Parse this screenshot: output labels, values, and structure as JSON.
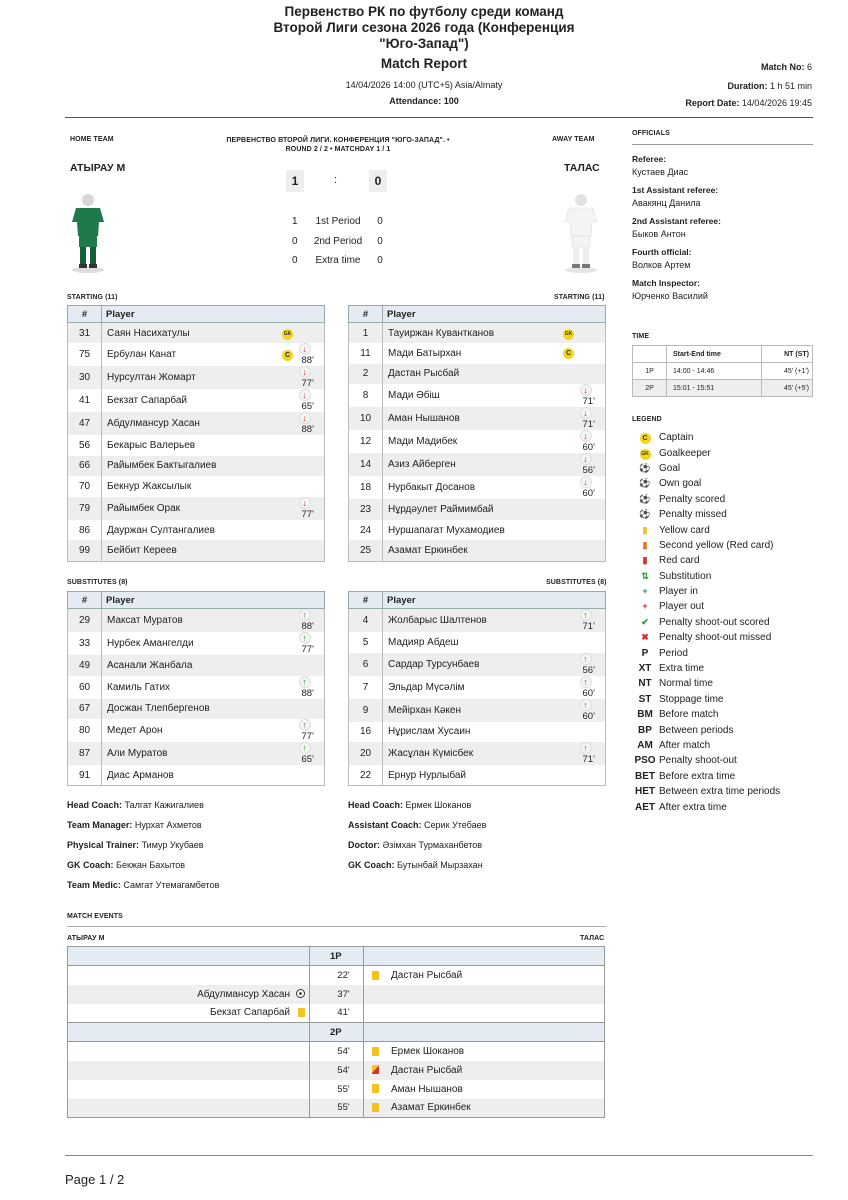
{
  "header": {
    "title_line1": "Первенство РК по футболу среди команд Второй Лиги сезона 2026 года (Конференция \"Юго-Запад\")",
    "subtitle": "Match Report",
    "datetime": "14/04/2026 14:00 (UTC+5) Asia/Almaty",
    "attendance": "Attendance: 100",
    "match_no_label": "Match No:",
    "match_no": "6",
    "duration_label": "Duration:",
    "duration": "1 h 51 min",
    "report_date_label": "Report Date:",
    "report_date": "14/04/2026 19:45"
  },
  "match": {
    "home_label": "HOME TEAM",
    "away_label": "AWAY TEAM",
    "competition": "ПЕРВЕНСТВО ВТОРОЙ ЛИГИ. КОНФЕРЕНЦИЯ \"ЮГО-ЗАПАД\". • ROUND 2 / 2 • MATCHDAY 1 / 1",
    "home_team": "АТЫРАУ М",
    "away_team": "ТАЛАС",
    "home_score": "1",
    "away_score": "0",
    "separator": ":",
    "periods": [
      {
        "home": "1",
        "label": "1st Period",
        "away": "0"
      },
      {
        "home": "0",
        "label": "2nd Period",
        "away": "0"
      },
      {
        "home": "0",
        "label": "Extra time",
        "away": "0"
      }
    ],
    "home_kit_color": "#1e7a4a",
    "away_kit_color": "#f2f2f2"
  },
  "starting_label": "STARTING (11)",
  "subs_label": "SUBSTITUTES (8)",
  "col_num": "#",
  "col_player": "Player",
  "home_starting": [
    {
      "num": "31",
      "name": "Саян Насихатулы",
      "badge": "GK",
      "dir": "",
      "min": ""
    },
    {
      "num": "75",
      "name": "Ербулан Канат",
      "badge": "C",
      "dir": "out",
      "min": "88'"
    },
    {
      "num": "30",
      "name": "Нурсултан Жомарт",
      "badge": "",
      "dir": "out",
      "min": "77'"
    },
    {
      "num": "41",
      "name": "Бекзат Сапарбай",
      "badge": "",
      "dir": "out",
      "min": "65'"
    },
    {
      "num": "47",
      "name": "Абдулмансур Хасан",
      "badge": "",
      "dir": "out",
      "min": "88'"
    },
    {
      "num": "56",
      "name": "Бекарыс Валерьев",
      "badge": "",
      "dir": "",
      "min": ""
    },
    {
      "num": "66",
      "name": "Райымбек Бактыгалиев",
      "badge": "",
      "dir": "",
      "min": ""
    },
    {
      "num": "70",
      "name": "Бекнур Жаксылык",
      "badge": "",
      "dir": "",
      "min": ""
    },
    {
      "num": "79",
      "name": "Райымбек Орак",
      "badge": "",
      "dir": "out",
      "min": "77'"
    },
    {
      "num": "86",
      "name": "Дауржан Султангалиев",
      "badge": "",
      "dir": "",
      "min": ""
    },
    {
      "num": "99",
      "name": "Бейбит Кереев",
      "badge": "",
      "dir": "",
      "min": ""
    }
  ],
  "away_starting": [
    {
      "num": "1",
      "name": "Тауиржан Кувантканов",
      "badge": "GK",
      "dir": "",
      "min": ""
    },
    {
      "num": "11",
      "name": "Мади Батырхан",
      "badge": "C",
      "dir": "",
      "min": ""
    },
    {
      "num": "2",
      "name": "Дастан Рысбай",
      "badge": "",
      "dir": "",
      "min": ""
    },
    {
      "num": "8",
      "name": "Мади Әбіш",
      "badge": "",
      "dir": "out",
      "min": "71'"
    },
    {
      "num": "10",
      "name": "Аман Нышанов",
      "badge": "",
      "dir": "out",
      "min": "71'"
    },
    {
      "num": "12",
      "name": "Мади Мадибек",
      "badge": "",
      "dir": "out",
      "min": "60'"
    },
    {
      "num": "14",
      "name": "Азиз Айберген",
      "badge": "",
      "dir": "out",
      "min": "56'"
    },
    {
      "num": "18",
      "name": "Нурбакыт Досанов",
      "badge": "",
      "dir": "out",
      "min": "60'"
    },
    {
      "num": "23",
      "name": "Нұрдәулет Раймимбай",
      "badge": "",
      "dir": "",
      "min": ""
    },
    {
      "num": "24",
      "name": "Нуршапагат Мухамодиев",
      "badge": "",
      "dir": "",
      "min": ""
    },
    {
      "num": "25",
      "name": "Азамат Еркинбек",
      "badge": "",
      "dir": "",
      "min": ""
    }
  ],
  "home_subs": [
    {
      "num": "29",
      "name": "Максат Муратов",
      "dir": "in",
      "min": "88'"
    },
    {
      "num": "33",
      "name": "Нурбек Амангелди",
      "dir": "in",
      "min": "77'"
    },
    {
      "num": "49",
      "name": "Асанали Жанбала",
      "dir": "",
      "min": ""
    },
    {
      "num": "60",
      "name": "Камиль Гатих",
      "dir": "in",
      "min": "88'"
    },
    {
      "num": "67",
      "name": "Досжан Тлепбергенов",
      "dir": "",
      "min": ""
    },
    {
      "num": "80",
      "name": "Медет Арон",
      "dir": "in",
      "min": "77'"
    },
    {
      "num": "87",
      "name": "Али Муратов",
      "dir": "in",
      "min": "65'"
    },
    {
      "num": "91",
      "name": "Диас Арманов",
      "dir": "",
      "min": ""
    }
  ],
  "away_subs": [
    {
      "num": "4",
      "name": "Жолбарыс Шалтенов",
      "dir": "in",
      "min": "71'"
    },
    {
      "num": "5",
      "name": "Мадияр Абдеш",
      "dir": "",
      "min": ""
    },
    {
      "num": "6",
      "name": "Сардар Турсунбаев",
      "dir": "in",
      "min": "56'"
    },
    {
      "num": "7",
      "name": "Эльдар Мүсәлім",
      "dir": "in",
      "min": "60'"
    },
    {
      "num": "9",
      "name": "Мейірхан Кәкен",
      "dir": "in",
      "min": "60'"
    },
    {
      "num": "16",
      "name": "Нұрислам Хусаин",
      "dir": "",
      "min": ""
    },
    {
      "num": "20",
      "name": "Жасұлан Күмісбек",
      "dir": "in",
      "min": "71'"
    },
    {
      "num": "22",
      "name": "Ернур Нурлыбай",
      "dir": "",
      "min": ""
    }
  ],
  "home_staff": [
    {
      "role": "Head Coach:",
      "name": "Талгат Кажигалиев"
    },
    {
      "role": "Team Manager:",
      "name": "Нурхат Ахметов"
    },
    {
      "role": "Physical Trainer:",
      "name": "Тимур Укубаев"
    },
    {
      "role": "GK Coach:",
      "name": "Бекжан Бахытов"
    },
    {
      "role": "Team Medic:",
      "name": "Самгат Утемагамбетов"
    }
  ],
  "away_staff": [
    {
      "role": "Head Coach:",
      "name": "Ермек Шоканов"
    },
    {
      "role": "Assistant Coach:",
      "name": "Серик Утебаев"
    },
    {
      "role": "Doctor:",
      "name": "Әзімхан Турмаханбетов"
    },
    {
      "role": "GK Coach:",
      "name": "Бутынбай Мырзахан"
    }
  ],
  "officials": {
    "heading": "OFFICIALS",
    "items": [
      {
        "label": "Referee:",
        "name": "Кустаев Диас"
      },
      {
        "label": "1st Assistant referee:",
        "name": "Авакянц Данила"
      },
      {
        "label": "2nd Assistant referee:",
        "name": "Быков Антон"
      },
      {
        "label": "Fourth official:",
        "name": "Волков Артем"
      },
      {
        "label": "Match Inspector:",
        "name": "Юрченко Василий"
      }
    ]
  },
  "time": {
    "heading": "TIME",
    "col1": "Start-End time",
    "col2": "NT (ST)",
    "rows": [
      {
        "p": "1P",
        "range": "14:00 - 14:46",
        "nt": "45' (+1')"
      },
      {
        "p": "2P",
        "range": "15:01 - 15:51",
        "nt": "45' (+5')"
      }
    ]
  },
  "legend": {
    "heading": "LEGEND",
    "items": [
      {
        "key": "C",
        "icon": "captain-icon",
        "label": "Captain"
      },
      {
        "key": "GK",
        "icon": "goalkeeper-icon",
        "label": "Goalkeeper"
      },
      {
        "key": "⚽",
        "icon": "goal-icon",
        "label": "Goal"
      },
      {
        "key": "⚽",
        "icon": "own-goal-icon",
        "label": "Own goal"
      },
      {
        "key": "⚽",
        "icon": "penalty-scored-icon",
        "label": "Penalty scored"
      },
      {
        "key": "⚽",
        "icon": "penalty-missed-icon",
        "label": "Penalty missed"
      },
      {
        "key": "▮",
        "icon": "yellow-card-icon",
        "label": "Yellow card"
      },
      {
        "key": "▮",
        "icon": "second-yellow-icon",
        "label": "Second yellow (Red card)"
      },
      {
        "key": "▮",
        "icon": "red-card-icon",
        "label": "Red card"
      },
      {
        "key": "⇅",
        "icon": "substitution-icon",
        "label": "Substitution"
      },
      {
        "key": "+",
        "icon": "player-in-icon",
        "label": "Player in"
      },
      {
        "key": "+",
        "icon": "player-out-icon",
        "label": "Player out"
      },
      {
        "key": "✔",
        "icon": "shootout-scored-icon",
        "label": "Penalty shoot-out scored"
      },
      {
        "key": "✖",
        "icon": "shootout-missed-icon",
        "label": "Penalty shoot-out missed"
      },
      {
        "key": "P",
        "icon": "",
        "label": "Period"
      },
      {
        "key": "XT",
        "icon": "",
        "label": "Extra time"
      },
      {
        "key": "NT",
        "icon": "",
        "label": "Normal time"
      },
      {
        "key": "ST",
        "icon": "",
        "label": "Stoppage time"
      },
      {
        "key": "BM",
        "icon": "",
        "label": "Before match"
      },
      {
        "key": "BP",
        "icon": "",
        "label": "Between periods"
      },
      {
        "key": "AM",
        "icon": "",
        "label": "After match"
      },
      {
        "key": "PSO",
        "icon": "",
        "label": "Penalty shoot-out"
      },
      {
        "key": "BET",
        "icon": "",
        "label": "Before extra time"
      },
      {
        "key": "HET",
        "icon": "",
        "label": "Between extra time periods"
      },
      {
        "key": "AET",
        "icon": "",
        "label": "After extra time"
      }
    ]
  },
  "events": {
    "heading": "MATCH EVENTS",
    "home": "АТЫРАУ М",
    "away": "ТАЛАС",
    "rows": [
      {
        "type": "period",
        "label": "1P"
      },
      {
        "type": "event",
        "home": "",
        "home_icon": "",
        "min": "22'",
        "away": "Дастан Рысбай",
        "away_icon": "yellow"
      },
      {
        "type": "event",
        "home": "Абдулмансур Хасан",
        "home_icon": "goal",
        "min": "37'",
        "away": "",
        "away_icon": ""
      },
      {
        "type": "event",
        "home": "Бекзат Сапарбай",
        "home_icon": "yellow",
        "min": "41'",
        "away": "",
        "away_icon": ""
      },
      {
        "type": "period",
        "label": "2P"
      },
      {
        "type": "event",
        "home": "",
        "home_icon": "",
        "min": "54'",
        "away": "Ермек Шоканов",
        "away_icon": "yellow"
      },
      {
        "type": "event",
        "home": "",
        "home_icon": "",
        "min": "54'",
        "away": "Дастан Рысбай",
        "away_icon": "second-yellow"
      },
      {
        "type": "event",
        "home": "",
        "home_icon": "",
        "min": "55'",
        "away": "Аман Нышанов",
        "away_icon": "yellow"
      },
      {
        "type": "event",
        "home": "",
        "home_icon": "",
        "min": "55'",
        "away": "Азамат Еркинбек",
        "away_icon": "yellow"
      }
    ]
  },
  "footer": {
    "page": "Page 1 / 2"
  }
}
